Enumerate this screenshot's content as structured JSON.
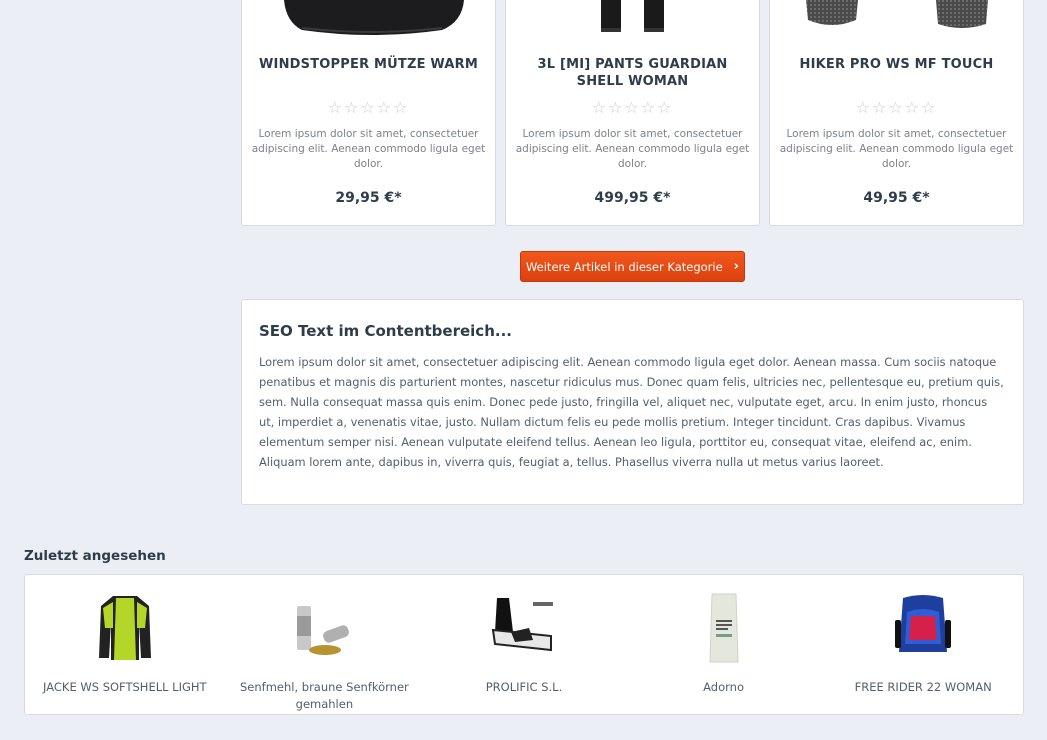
{
  "products": [
    {
      "name": "WINDSTOPPER MÜTZE WARM",
      "rating": "☆☆☆☆☆",
      "description": "Lorem ipsum dolor sit amet, consectetuer adipiscing elit. Aenean commodo ligula eget dolor.",
      "price": "29,95 €*"
    },
    {
      "name": "3L [MI] PANTS GUARDIAN SHELL WOMAN",
      "rating": "☆☆☆☆☆",
      "description": "Lorem ipsum dolor sit amet, consectetuer adipiscing elit. Aenean commodo ligula eget dolor.",
      "price": "499,95 €*"
    },
    {
      "name": "HIKER PRO WS MF TOUCH",
      "rating": "☆☆☆☆☆",
      "description": "Lorem ipsum dolor sit amet, consectetuer adipiscing elit. Aenean commodo ligula eget dolor.",
      "price": "49,95 €*"
    }
  ],
  "more_button": {
    "label": "Weitere Artikel in dieser Kategorie",
    "icon": "chevron-right-icon"
  },
  "seo": {
    "title": "SEO Text im Contentbereich...",
    "text": "Lorem ipsum dolor sit amet, consectetuer adipiscing elit. Aenean commodo ligula eget dolor. Aenean massa. Cum sociis natoque penatibus et magnis dis parturient montes, nascetur ridiculus mus. Donec quam felis, ultricies nec, pellentesque eu, pretium quis, sem. Nulla consequat massa quis enim. Donec pede justo, fringilla vel, aliquet nec, vulputate eget, arcu. In enim justo, rhoncus ut, imperdiet a, venenatis vitae, justo. Nullam dictum felis eu pede mollis pretium. Integer tincidunt. Cras dapibus. Vivamus elementum semper nisi. Aenean vulputate eleifend tellus. Aenean leo ligula, porttitor eu, consequat vitae, eleifend ac, enim. Aliquam lorem ante, dapibus in, viverra quis, feugiat a, tellus. Phasellus viverra nulla ut metus varius laoreet."
  },
  "recently_viewed": {
    "title": "Zuletzt angesehen",
    "items": [
      {
        "label": "JACKE WS SOFTSHELL LIGHT"
      },
      {
        "label": "Senfmehl, braune Senfkörner gemahlen"
      },
      {
        "label": "PROLIFIC S.L."
      },
      {
        "label": "Adorno"
      },
      {
        "label": "FREE RIDER 22 WOMAN"
      }
    ]
  },
  "colors": {
    "accent": "#e84e14",
    "background": "#eceef5",
    "text": "#52606d",
    "heading": "#2f3d4a"
  }
}
